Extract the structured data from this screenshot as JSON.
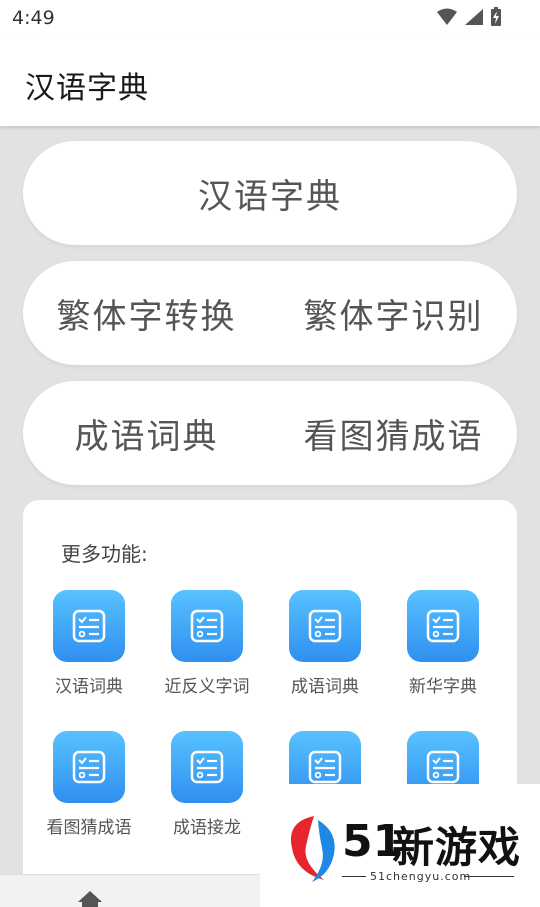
{
  "status_bar": {
    "time": "4:49"
  },
  "appbar": {
    "title": "汉语字典"
  },
  "cards": {
    "main": "汉语字典",
    "row2": [
      "繁体字转换",
      "繁体字识别"
    ],
    "row3": [
      "成语词典",
      "看图猜成语"
    ]
  },
  "more": {
    "title": "更多功能:",
    "items": [
      {
        "label": "汉语词典",
        "icon": "checklist-icon"
      },
      {
        "label": "近反义字词",
        "icon": "checklist-icon"
      },
      {
        "label": "成语词典",
        "icon": "checklist-icon"
      },
      {
        "label": "新华字典",
        "icon": "checklist-icon"
      },
      {
        "label": "看图猜成语",
        "icon": "checklist-icon"
      },
      {
        "label": "成语接龙",
        "icon": "checklist-icon"
      },
      {
        "label": "",
        "icon": "checklist-icon"
      },
      {
        "label": "",
        "icon": "checklist-icon"
      }
    ]
  },
  "watermark": {
    "number": "51",
    "name": "新游戏",
    "url": "51chengyu.com"
  },
  "colors": {
    "tile_top": "#58c2ff",
    "tile_bottom": "#2f8ff0",
    "background": "#e2e2e2"
  }
}
